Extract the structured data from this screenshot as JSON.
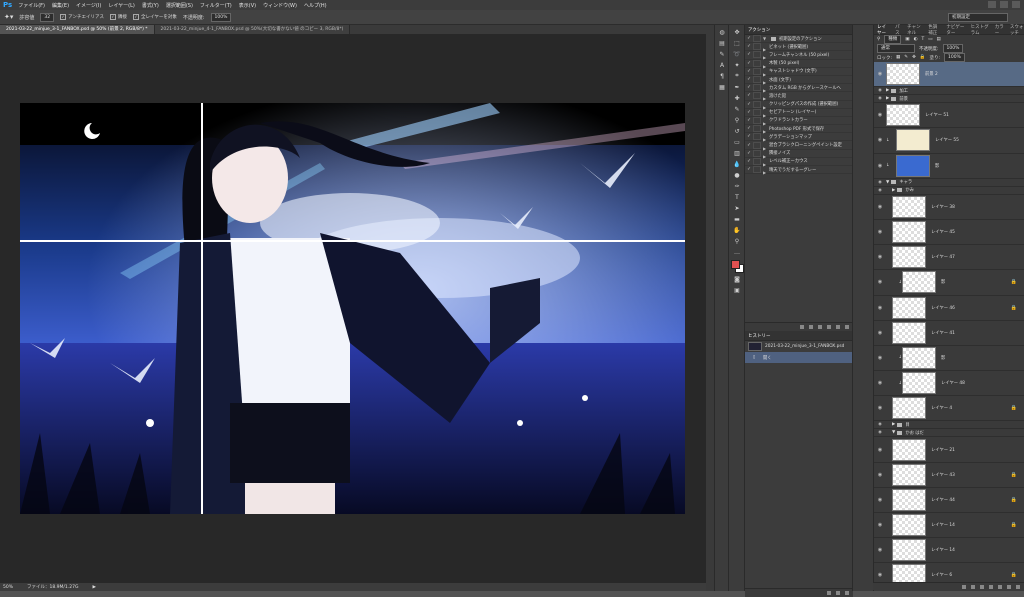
{
  "app": {
    "logo": "Ps",
    "menu": [
      "ファイル(F)",
      "編集(E)",
      "イメージ(I)",
      "レイヤー(L)",
      "書式(Y)",
      "選択範囲(S)",
      "フィルター(T)",
      "表示(V)",
      "ウィンドウ(W)",
      "ヘルプ(H)"
    ]
  },
  "options": {
    "size_label": "許容値",
    "size_value": "32",
    "antialias": "アンチエイリアス",
    "contiguous": "隣接",
    "all_layers": "全レイヤーを対象",
    "opacity_label": "不透明度:",
    "opacity_value": "100%",
    "workspace": "初期設定"
  },
  "tabs": [
    {
      "label": "2021-03-22_minjue_3-1_FANBOX.psd @ 50% (前景 2, RGB/8*) *",
      "active": true
    },
    {
      "label": "2021-03-22_minjue_4-1_FANBOX.psd @ 50%(大切な書かない値 のコピー 3, RGB/8*)",
      "active": false
    }
  ],
  "status": {
    "zoom": "50%",
    "file": "ファイル：18.9M/1.27G"
  },
  "actions_panel": {
    "tabs": [
      "アクション"
    ],
    "items": [
      {
        "label": "初期設定のアクション",
        "kind": "folder"
      },
      {
        "label": "ビネット (選択範囲)"
      },
      {
        "label": "フレームチャンネル (50 pixel)"
      },
      {
        "label": "木製 (50 pixel)"
      },
      {
        "label": "キャストシャドウ (文字)"
      },
      {
        "label": "水面 (文字)"
      },
      {
        "label": "カスタム RGB からグレースケールへ"
      },
      {
        "label": "溶けた鉛"
      },
      {
        "label": "クリッピングパスの作成 (選択範囲)"
      },
      {
        "label": "セピアトーン (レイヤー)"
      },
      {
        "label": "クワドラントカラー"
      },
      {
        "label": "Photoshop PDF 形式で保存"
      },
      {
        "label": "グラデーションマップ"
      },
      {
        "label": "混合ブラシクローニングペイント設定"
      },
      {
        "label": "隣接ノイズ"
      },
      {
        "label": "レベル補正ーカウス"
      },
      {
        "label": "晴天でうだするーグレー"
      }
    ]
  },
  "history_panel": {
    "title": "ヒストリー",
    "items": [
      {
        "label": "2021-03-22_minjue_3-1_FANBOX.psd",
        "selected": false
      },
      {
        "label": "開く",
        "selected": true
      }
    ]
  },
  "layers_panel": {
    "tabs": [
      "レイヤー",
      "パス",
      "チャンネル",
      "色調補正",
      "ナビゲーター",
      "ヒストグラム",
      "カラー",
      "スウォッチ"
    ],
    "filter": "種類",
    "blend_mode": "通常",
    "opacity_label": "不透明度:",
    "opacity_value": "100%",
    "lock_label": "ロック:",
    "fill_label": "塗り:",
    "fill_value": "100%",
    "items": [
      {
        "type": "layer",
        "name": "前景 2",
        "selected": true
      },
      {
        "type": "group",
        "name": "加工"
      },
      {
        "type": "group",
        "name": "前景"
      },
      {
        "type": "layer",
        "name": "レイヤー 51"
      },
      {
        "type": "layer",
        "name": "レイヤー 55",
        "clip": true
      },
      {
        "type": "layer",
        "name": "影",
        "clip": true
      },
      {
        "type": "group",
        "name": "キャラ",
        "open": true
      },
      {
        "type": "group",
        "name": "かみ",
        "indent": true
      },
      {
        "type": "layer",
        "name": "レイヤー 38",
        "indent": true
      },
      {
        "type": "layer",
        "name": "レイヤー 45",
        "indent": true
      },
      {
        "type": "layer",
        "name": "レイヤー 47",
        "indent": true
      },
      {
        "type": "layer",
        "name": "影",
        "clip": true,
        "lock": true
      },
      {
        "type": "layer",
        "name": "レイヤー 46",
        "indent": true,
        "lock": true
      },
      {
        "type": "layer",
        "name": "レイヤー 41",
        "indent": true
      },
      {
        "type": "layer",
        "name": "影",
        "clip": true
      },
      {
        "type": "layer",
        "name": "レイヤー 48",
        "clip": true
      },
      {
        "type": "layer",
        "name": "レイヤー 4",
        "indent": true,
        "lock": true
      },
      {
        "type": "group",
        "name": "目",
        "indent": true
      },
      {
        "type": "group",
        "name": "かお はだ",
        "indent": true
      },
      {
        "type": "layer",
        "name": "レイヤー 21",
        "indent": true
      },
      {
        "type": "layer",
        "name": "レイヤー 43",
        "indent": true,
        "lock": true
      },
      {
        "type": "layer",
        "name": "レイヤー 44",
        "indent": true,
        "lock": true
      },
      {
        "type": "layer",
        "name": "レイヤー 14",
        "indent": true,
        "lock": true
      },
      {
        "type": "layer",
        "name": "レイヤー 14",
        "indent": true
      },
      {
        "type": "layer",
        "name": "レイヤー 6",
        "indent": true,
        "lock": true
      }
    ]
  },
  "colors": {
    "foreground": "#e05050",
    "background": "#ffffff",
    "accent": "#31a8ff"
  }
}
